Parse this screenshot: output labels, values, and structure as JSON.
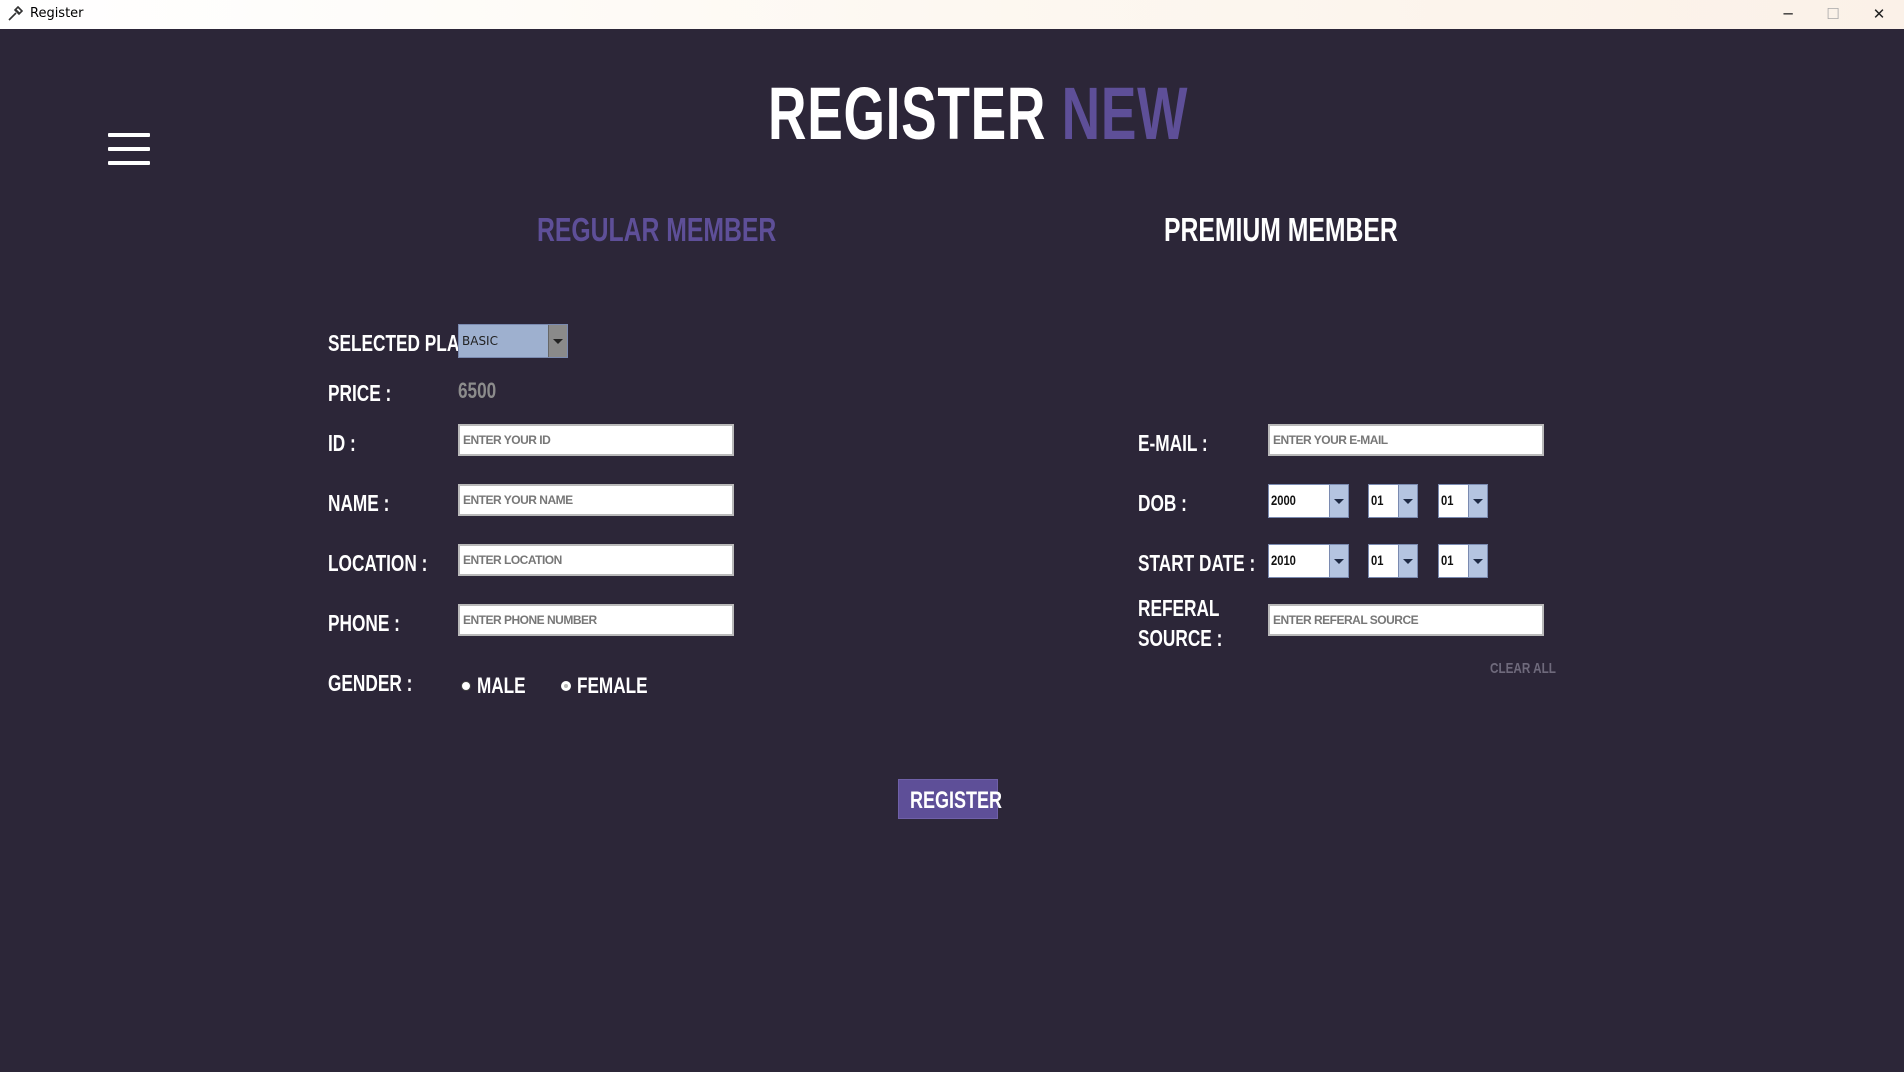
{
  "window": {
    "title": "Register",
    "minimize_glyph": "─",
    "maximize_glyph": "☐",
    "close_glyph": "✕"
  },
  "heading": {
    "part1": "REGISTER",
    "part2": "NEW"
  },
  "tabs": {
    "regular": "REGULAR MEMBER",
    "premium": "PREMIUM MEMBER"
  },
  "form": {
    "selected_plan_label": "SELECTED PLAN :",
    "selected_plan_value": "BASIC",
    "price_label": "PRICE :",
    "price_value": "6500",
    "id_label": "ID :",
    "id_placeholder": "ENTER YOUR ID",
    "name_label": "NAME :",
    "name_placeholder": "ENTER YOUR NAME",
    "location_label": "LOCATION :",
    "location_placeholder": "ENTER LOCATION",
    "phone_label": "PHONE :",
    "phone_placeholder": "ENTER PHONE NUMBER",
    "gender_label": "GENDER :",
    "gender_male": "MALE",
    "gender_female": "FEMALE",
    "gender_selected": "FEMALE",
    "email_label": "E-MAIL :",
    "email_placeholder": "ENTER YOUR E-MAIL",
    "dob_label": "DOB :",
    "dob_year": "2000",
    "dob_month": "01",
    "dob_day": "01",
    "start_date_label": "START DATE :",
    "start_year": "2010",
    "start_month": "01",
    "start_day": "01",
    "referral_label_line1": "REFERAL",
    "referral_label_line2": "SOURCE :",
    "referral_placeholder": "ENTER REFERAL SOURCE",
    "clear_all": "CLEAR ALL",
    "register_button": "REGISTER"
  },
  "colors": {
    "background": "#2c2638",
    "accent": "#5e4f98",
    "text": "#ffffff"
  },
  "icons": {
    "app": "tools-icon",
    "menu": "hamburger-menu-icon"
  }
}
